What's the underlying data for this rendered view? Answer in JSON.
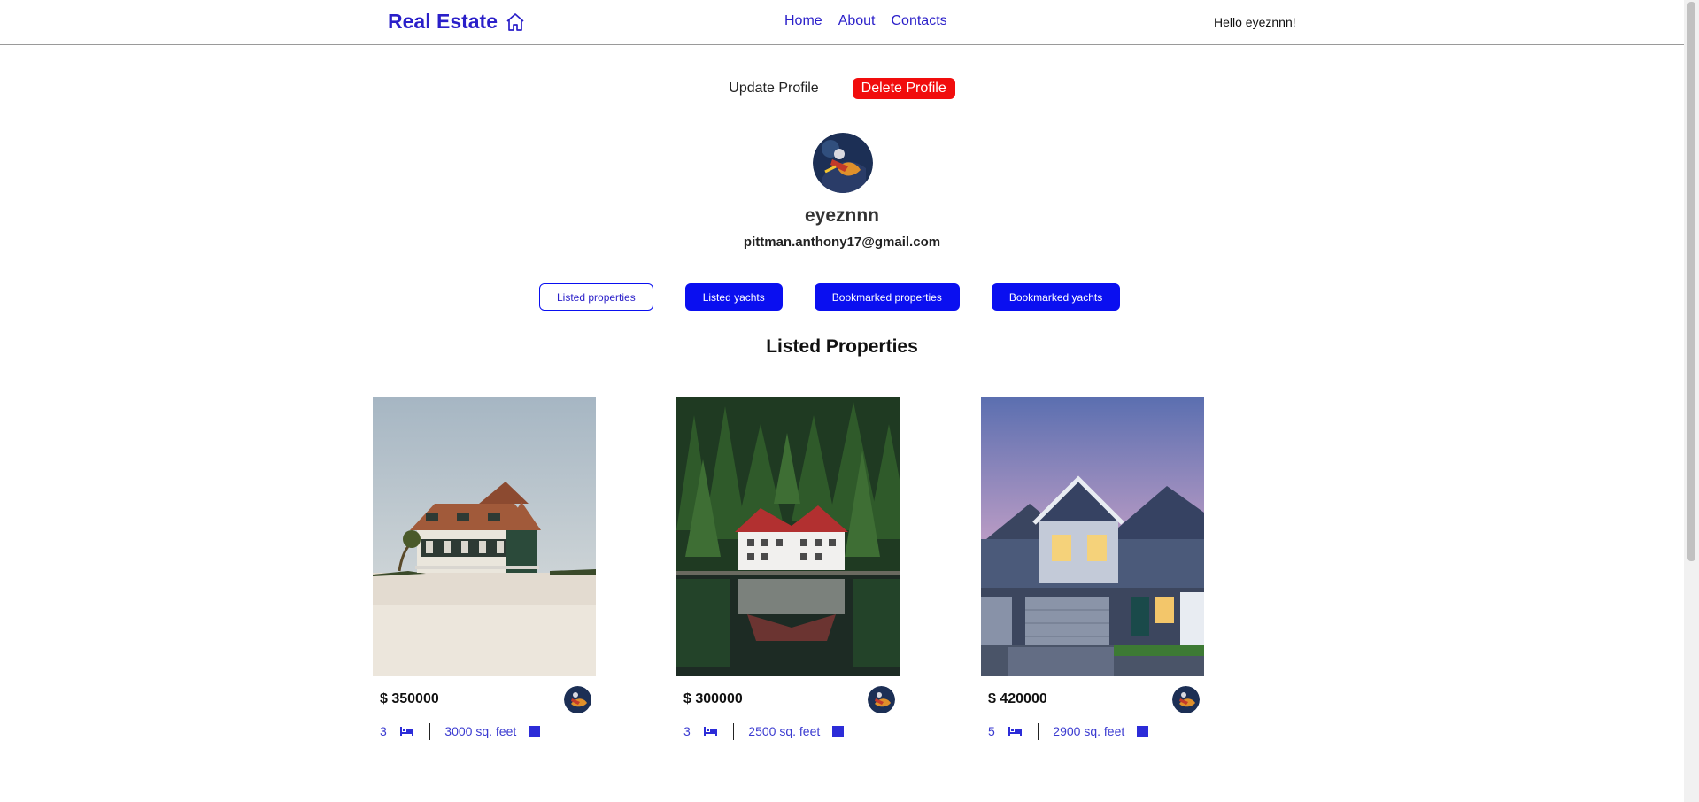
{
  "header": {
    "brand": "Real Estate",
    "brand_icon": "home-icon",
    "nav": [
      "Home",
      "About",
      "Contacts"
    ],
    "greeting": "Hello eyeznnn!"
  },
  "profile": {
    "update_label": "Update Profile",
    "delete_label": "Delete Profile",
    "username": "eyeznnn",
    "email": "pittman.anthony17@gmail.com"
  },
  "tabs": [
    "Listed properties",
    "Listed yachts",
    "Bookmarked properties",
    "Bookmarked yachts"
  ],
  "active_tab": "Listed properties",
  "section_title": "Listed Properties",
  "listings": [
    {
      "price": "$ 350000",
      "beds": "3",
      "area": "3000 sq. feet"
    },
    {
      "price": "$ 300000",
      "beds": "3",
      "area": "2500 sq. feet"
    },
    {
      "price": "$ 420000",
      "beds": "5",
      "area": "2900 sq. feet"
    }
  ],
  "colors": {
    "accent": "#2a1fc9",
    "button": "#0a0ff0",
    "danger": "#f10d0d"
  }
}
